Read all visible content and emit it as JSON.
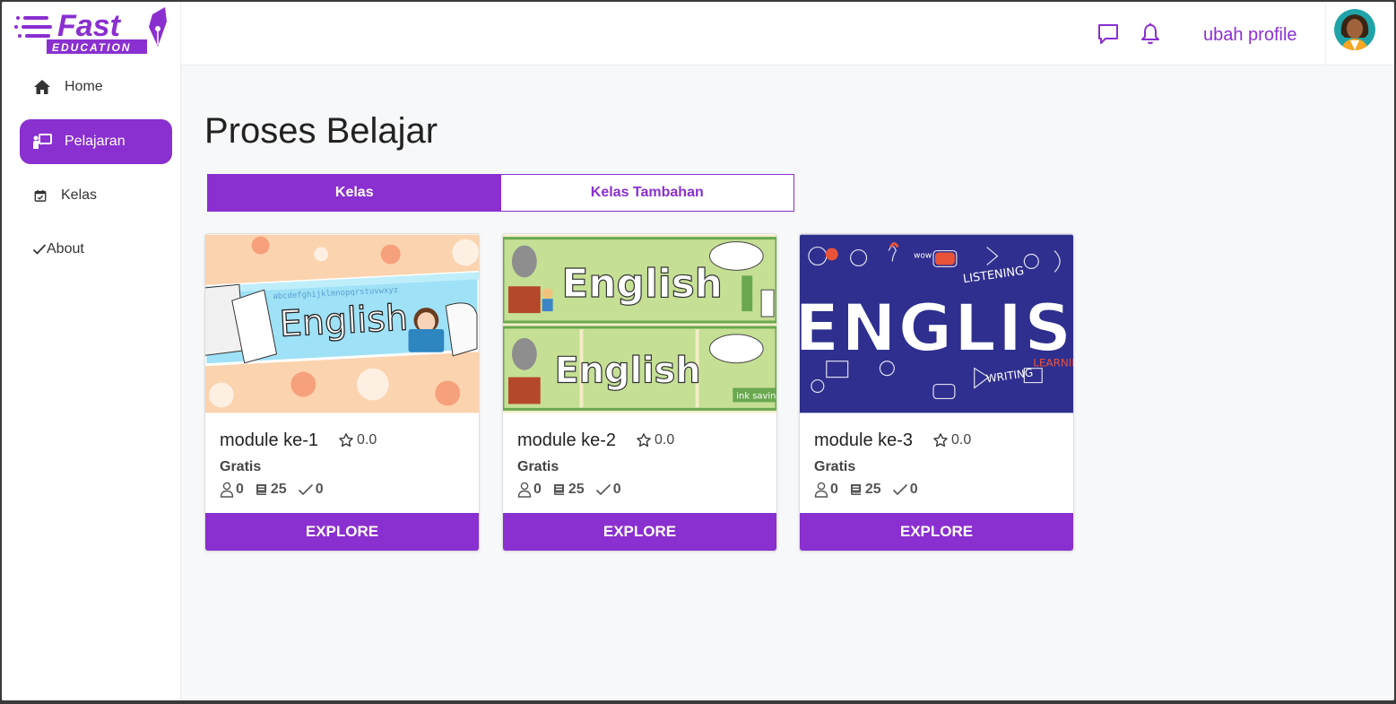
{
  "brand": {
    "name": "Fast",
    "tagline": "EDUCATION",
    "accent": "#8a2fd0"
  },
  "sidebar": {
    "items": [
      {
        "label": "Home",
        "icon": "home-icon",
        "active": false
      },
      {
        "label": "Pelajaran",
        "icon": "teacher-board-icon",
        "active": true
      },
      {
        "label": "Kelas",
        "icon": "calendar-check-icon",
        "active": false
      },
      {
        "label": "About",
        "icon": "check-icon",
        "active": false
      }
    ]
  },
  "header": {
    "chat_icon": "chat-icon",
    "bell_icon": "bell-icon",
    "profile_link": "ubah profile",
    "avatar_icon": "avatar"
  },
  "main": {
    "title": "Proses Belajar",
    "tabs": [
      {
        "label": "Kelas",
        "active": true
      },
      {
        "label": "Kelas Tambahan",
        "active": false
      }
    ],
    "cards": [
      {
        "title": "module ke-1",
        "rating": "0.0",
        "price": "Gratis",
        "students": "0",
        "lessons": "25",
        "completed": "0",
        "button": "EXPLORE",
        "image_text": "English",
        "image_subtext": "abcdefghijklmnopqrstuvwxyz"
      },
      {
        "title": "module ke-2",
        "rating": "0.0",
        "price": "Gratis",
        "students": "0",
        "lessons": "25",
        "completed": "0",
        "button": "EXPLORE",
        "image_text": "English",
        "image_subtext": "ink savin"
      },
      {
        "title": "module ke-3",
        "rating": "0.0",
        "price": "Gratis",
        "students": "0",
        "lessons": "25",
        "completed": "0",
        "button": "EXPLORE",
        "image_text": "ENGLISH",
        "image_subtext": "LISTENING",
        "image_subtext2": "WRITING",
        "image_subtext3": "LEARNIN",
        "image_subtext4": "wow"
      }
    ]
  }
}
